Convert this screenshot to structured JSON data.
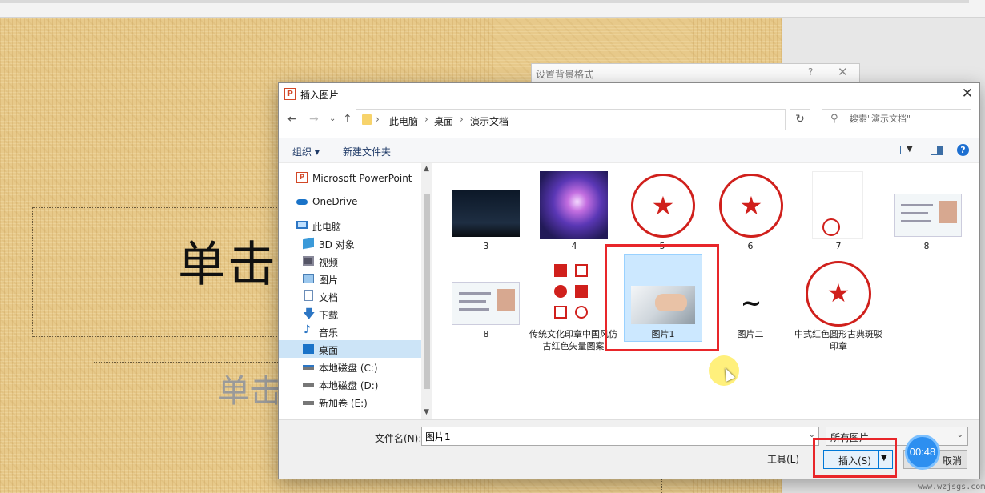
{
  "slide": {
    "title_placeholder": "单击",
    "subtitle_placeholder": "单击"
  },
  "background_dialog": {
    "title": "设置背景格式",
    "help": "?",
    "close": "✕"
  },
  "dialog": {
    "title": "插入图片",
    "close": "✕",
    "address": {
      "crumbs": [
        "此电脑",
        "桌面",
        "演示文档"
      ]
    },
    "search_placeholder": "搜索\"演示文档\"",
    "toolbar": {
      "organize": "组织 ▾",
      "new_folder": "新建文件夹",
      "help": "?"
    },
    "sidebar": [
      {
        "label": "Microsoft PowerPoint",
        "icon": "powerpoint-icon"
      },
      {
        "label": "OneDrive",
        "icon": "cloud-icon"
      },
      {
        "label": "此电脑",
        "icon": "computer-icon"
      },
      {
        "label": "3D 对象",
        "icon": "cube-icon"
      },
      {
        "label": "视频",
        "icon": "video-icon"
      },
      {
        "label": "图片",
        "icon": "picture-icon"
      },
      {
        "label": "文档",
        "icon": "document-icon"
      },
      {
        "label": "下载",
        "icon": "download-icon"
      },
      {
        "label": "音乐",
        "icon": "music-icon"
      },
      {
        "label": "桌面",
        "icon": "desktop-icon",
        "selected": true
      },
      {
        "label": "本地磁盘 (C:)",
        "icon": "drive-icon"
      },
      {
        "label": "本地磁盘 (D:)",
        "icon": "drive-icon"
      },
      {
        "label": "新加卷 (E:)",
        "icon": "drive-icon"
      }
    ],
    "files": [
      {
        "name": "3",
        "kind": "night-sky"
      },
      {
        "name": "4",
        "kind": "galaxy"
      },
      {
        "name": "5",
        "kind": "stamp"
      },
      {
        "name": "6",
        "kind": "stamp"
      },
      {
        "name": "7",
        "kind": "document"
      },
      {
        "name": "8",
        "kind": "id-card"
      },
      {
        "name": "8",
        "kind": "id-card"
      },
      {
        "name": "传统文化印章中国风仿古红色矢量图案",
        "kind": "seals"
      },
      {
        "name": "图片1",
        "kind": "keyboard",
        "selected": true
      },
      {
        "name": "图片二",
        "kind": "calligraphy"
      },
      {
        "name": "中式红色圆形古典斑驳印章",
        "kind": "stamp"
      }
    ],
    "filename_label": "文件名(N):",
    "filename_value": "图片1",
    "filetype": "所有图片",
    "tools": "工具(L)",
    "insert": "插入(S)",
    "cancel": "取消"
  },
  "overlay": {
    "timer": "00:48",
    "watermark": "www.wzjsgs.com"
  },
  "colors": {
    "highlight": "#e8262a",
    "selection": "#cce8ff",
    "accent": "#0078d7"
  }
}
